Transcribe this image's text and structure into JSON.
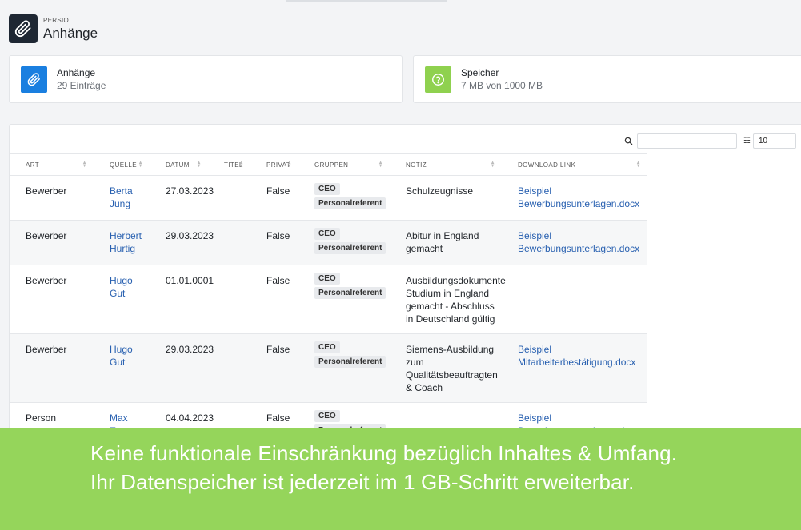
{
  "header": {
    "brand_sub": "PERSIO.",
    "title": "Anhänge",
    "logo_icon": "paperclip-icon"
  },
  "stats": [
    {
      "label": "Anhänge",
      "value": "29 Einträge",
      "icon": "paperclip-icon",
      "color": "#1a7fe0"
    },
    {
      "label": "Speicher",
      "value": "7 MB von 1000 MB",
      "icon": "question-circle-icon",
      "color": "#8fd14f"
    }
  ],
  "toolbar": {
    "search_value": "",
    "page_size": "10",
    "page_size_icon": "list-icon"
  },
  "table": {
    "columns": [
      "ART",
      "QUELLE",
      "DATUM",
      "TITEL",
      "PRIVAT",
      "GRUPPEN",
      "NOTIZ",
      "DOWNLOAD LINK"
    ],
    "rows": [
      {
        "art": "Bewerber",
        "quelle": "Berta Jung",
        "datum": "27.03.2023",
        "titel": "",
        "privat": "False",
        "gruppen": [
          "CEO",
          "Personalreferent"
        ],
        "notiz": "Schulzeugnisse",
        "link": "Beispiel Bewerbungsunterlagen.docx"
      },
      {
        "art": "Bewerber",
        "quelle": "Herbert Hurtig",
        "datum": "29.03.2023",
        "titel": "",
        "privat": "False",
        "gruppen": [
          "CEO",
          "Personalreferent"
        ],
        "notiz": "Abitur in England gemacht",
        "link": "Beispiel Bewerbungsunterlagen.docx"
      },
      {
        "art": "Bewerber",
        "quelle": "Hugo Gut",
        "datum": "01.01.0001",
        "titel": "",
        "privat": "False",
        "gruppen": [
          "CEO",
          "Personalreferent"
        ],
        "notiz": "Ausbildungsdokumente Studium in England gemacht - Abschluss in Deutschland gültig",
        "link": ""
      },
      {
        "art": "Bewerber",
        "quelle": "Hugo Gut",
        "datum": "29.03.2023",
        "titel": "",
        "privat": "False",
        "gruppen": [
          "CEO",
          "Personalreferent"
        ],
        "notiz": "Siemens-Ausbildung zum Qualitätsbeauftragten & Coach",
        "link": "Beispiel Mitarbeiterbestätigung.docx"
      },
      {
        "art": "Person",
        "quelle": "Max Erster",
        "datum": "04.04.2023",
        "titel": "",
        "privat": "False",
        "gruppen": [
          "CEO",
          "Personalreferent"
        ],
        "notiz": "",
        "link": "Beispiel Bewerbungsunterlagen.docx"
      }
    ]
  },
  "banner": {
    "line1": "Keine funktionale Einschränkung bezüglich Inhaltes & Umfang.",
    "line2": "Ihr Datenspeicher ist jederzeit im 1 GB-Schritt erweiterbar.",
    "color": "#95d55b"
  }
}
